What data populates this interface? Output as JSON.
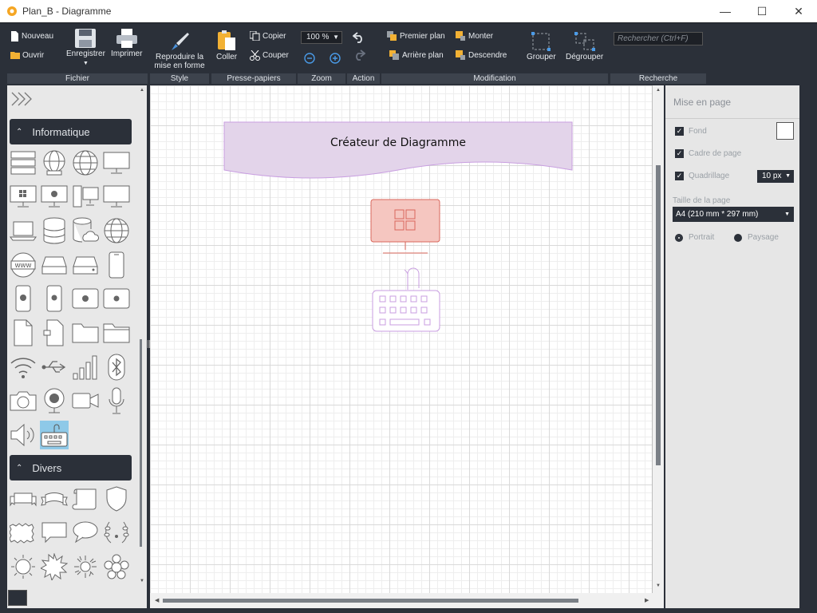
{
  "window": {
    "title": "Plan_B - Diagramme"
  },
  "ribbon": {
    "fichier": {
      "label": "Fichier",
      "nouveau": "Nouveau",
      "ouvrir": "Ouvrir",
      "enregistrer": "Enregistrer",
      "imprimer": "Imprimer"
    },
    "style": {
      "label": "Style",
      "reproduire": "Reproduire la mise en forme"
    },
    "presse_papiers": {
      "label": "Presse-papiers",
      "coller": "Coller",
      "copier": "Copier",
      "couper": "Couper"
    },
    "zoom": {
      "label": "Zoom",
      "value": "100 %"
    },
    "action": {
      "label": "Action"
    },
    "modification": {
      "label": "Modification",
      "premier_plan": "Premier plan",
      "arriere_plan": "Arrière plan",
      "monter": "Monter",
      "descendre": "Descendre",
      "grouper": "Grouper",
      "degrouper": "Dégrouper"
    },
    "recherche": {
      "label": "Recherche",
      "placeholder": "Rechercher (Ctrl+F)"
    }
  },
  "left_panel": {
    "sections": [
      {
        "label": "Informatique"
      },
      {
        "label": "Divers"
      }
    ]
  },
  "canvas": {
    "banner_text": "Créateur de Diagramme",
    "colors": {
      "banner_fill": "#e3d4ea",
      "banner_stroke": "#c89ee0",
      "monitor_fill": "#f5c6c0",
      "monitor_stroke": "#d9675b",
      "keyboard_stroke": "#c89ee0"
    }
  },
  "right_panel": {
    "title": "Mise en page",
    "fond": "Fond",
    "cadre": "Cadre de page",
    "quadrillage": "Quadrillage",
    "grid_size": "10 px",
    "page_size_label": "Taille de la page",
    "page_size": "A4 (210 mm * 297 mm)",
    "portrait": "Portrait",
    "paysage": "Paysage"
  }
}
